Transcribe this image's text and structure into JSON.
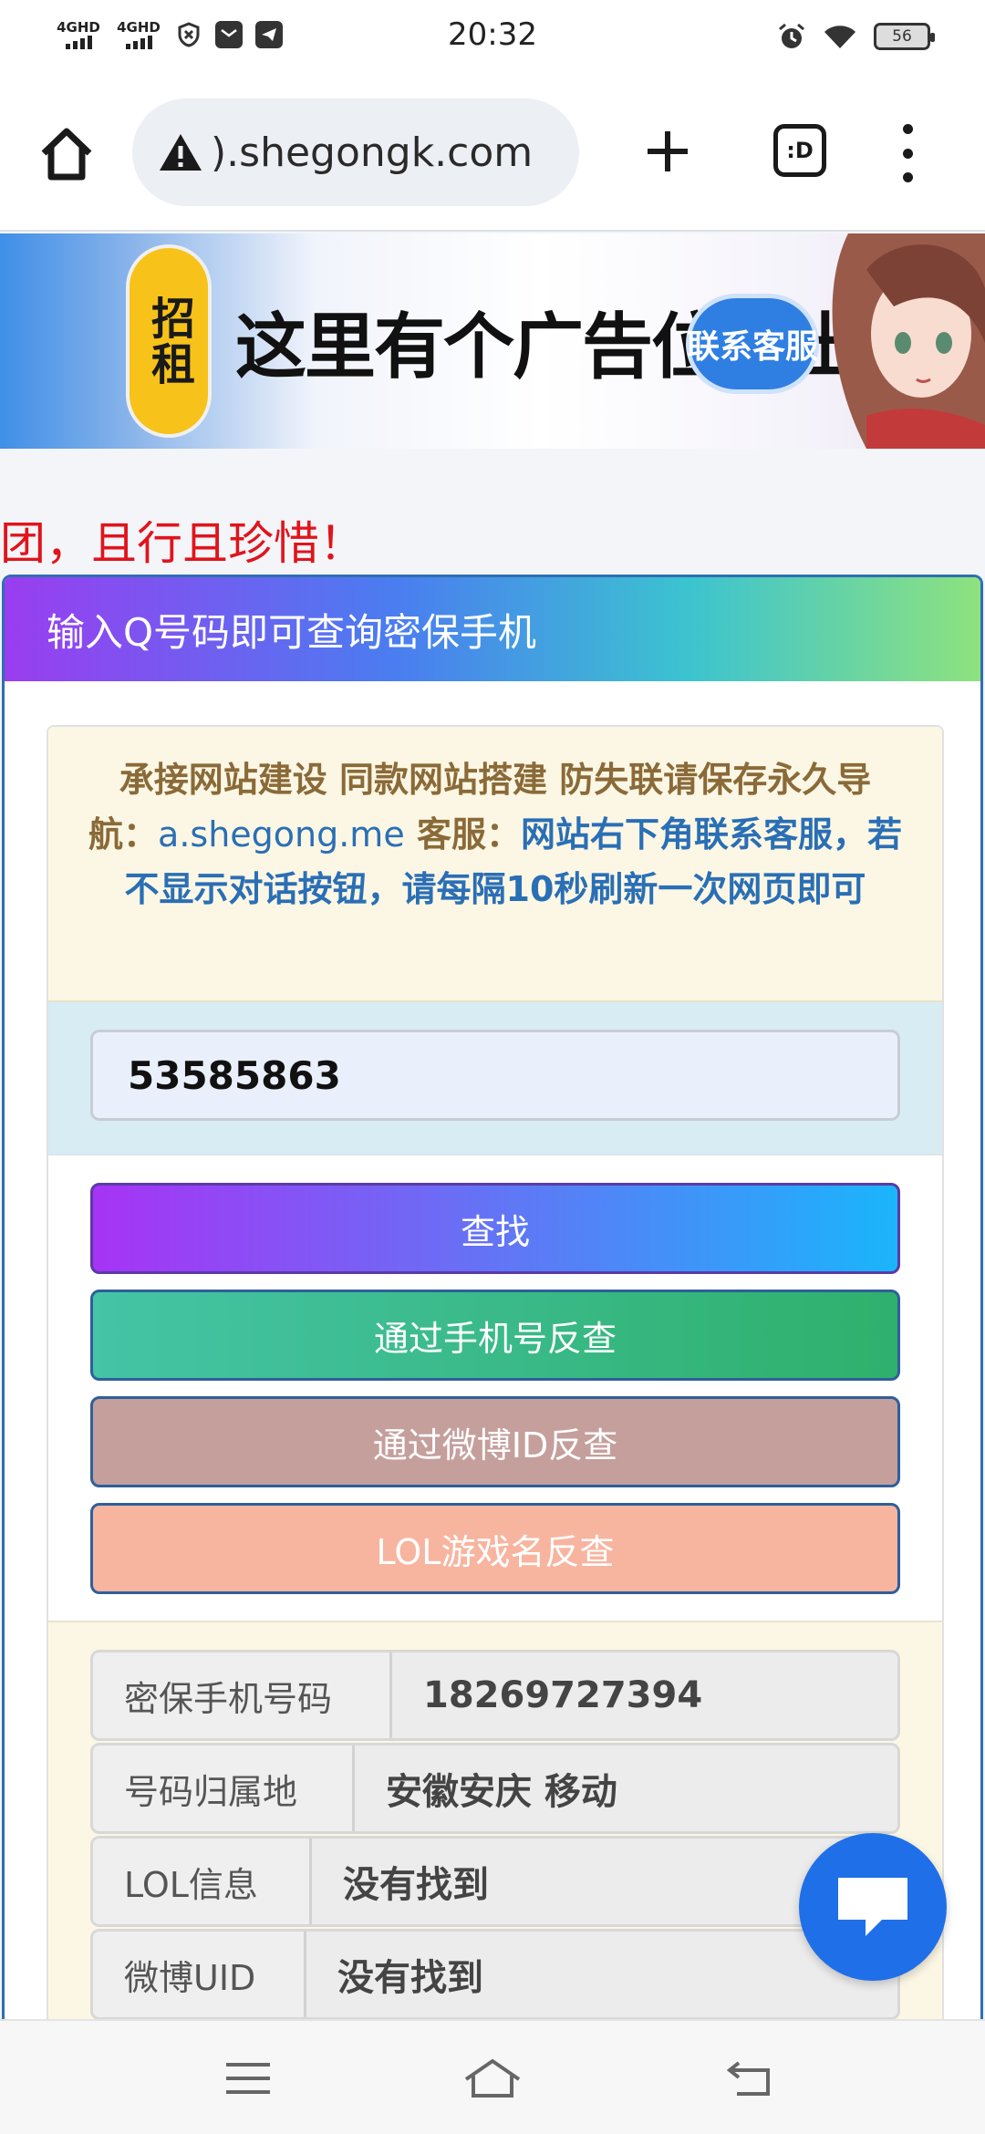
{
  "status_bar": {
    "signal1": "4GHD",
    "signal2": "4GHD",
    "time": "20:32",
    "battery": "56"
  },
  "browser": {
    "url": ").shegongk.com",
    "tabs_label": ":D"
  },
  "ad": {
    "badge": "招租",
    "text": "这里有个广告位要出租",
    "button": "联系客服"
  },
  "marquee": "团，且行且珍惜！",
  "panel": {
    "title": "输入Q号码即可查询密保手机"
  },
  "notice": {
    "line_a": "承接网站建设   同款网站搭建   防失联请保存永久导航：",
    "link": "a.shegong.me",
    "label_service": "  客服：",
    "line_b": "网站右下角联系客服，若不显示对话按钮，请每隔10秒刷新一次网页即可"
  },
  "search": {
    "value": "53585863"
  },
  "buttons": {
    "find": "查找",
    "by_phone": "通过手机号反查",
    "by_weibo": "通过微博ID反查",
    "by_lol": "LOL游戏名反查"
  },
  "results": [
    {
      "key": "密保手机号码",
      "value": "18269727394"
    },
    {
      "key": "号码归属地",
      "value": "安徽安庆 移动"
    },
    {
      "key": "LOL信息",
      "value": "没有找到"
    },
    {
      "key": "微博UID",
      "value": "没有找到"
    }
  ],
  "colors": {
    "accent_blue": "#1f6fe8",
    "marquee_red": "#e0141c"
  }
}
